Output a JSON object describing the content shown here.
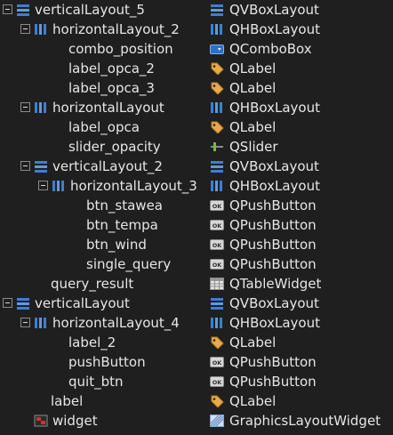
{
  "object_tree": {
    "rows": [
      {
        "object": "verticalLayout_5",
        "class": "QVBoxLayout",
        "depth": 0,
        "expanded": true,
        "object_icon": "vbox-layout-icon",
        "class_icon": "vbox-layout-icon"
      },
      {
        "object": "horizontalLayout_2",
        "class": "QHBoxLayout",
        "depth": 1,
        "expanded": true,
        "object_icon": "hbox-layout-icon",
        "class_icon": "hbox-layout-icon"
      },
      {
        "object": "combo_position",
        "class": "QComboBox",
        "depth": 2,
        "object_icon": "",
        "class_icon": "combobox-icon"
      },
      {
        "object": "label_opca_2",
        "class": "QLabel",
        "depth": 2,
        "object_icon": "",
        "class_icon": "label-icon"
      },
      {
        "object": "label_opca_3",
        "class": "QLabel",
        "depth": 2,
        "object_icon": "",
        "class_icon": "label-icon"
      },
      {
        "object": "horizontalLayout",
        "class": "QHBoxLayout",
        "depth": 1,
        "expanded": true,
        "object_icon": "hbox-layout-icon",
        "class_icon": "hbox-layout-icon"
      },
      {
        "object": "label_opca",
        "class": "QLabel",
        "depth": 2,
        "object_icon": "",
        "class_icon": "label-icon"
      },
      {
        "object": "slider_opacity",
        "class": "QSlider",
        "depth": 2,
        "object_icon": "",
        "class_icon": "slider-icon"
      },
      {
        "object": "verticalLayout_2",
        "class": "QVBoxLayout",
        "depth": 1,
        "expanded": true,
        "object_icon": "vbox-layout-icon",
        "class_icon": "vbox-layout-icon"
      },
      {
        "object": "horizontalLayout_3",
        "class": "QHBoxLayout",
        "depth": 2,
        "expanded": true,
        "object_icon": "hbox-layout-icon",
        "class_icon": "hbox-layout-icon"
      },
      {
        "object": "btn_stawea",
        "class": "QPushButton",
        "depth": 3,
        "object_icon": "",
        "class_icon": "push-button-icon"
      },
      {
        "object": "btn_tempa",
        "class": "QPushButton",
        "depth": 3,
        "object_icon": "",
        "class_icon": "push-button-icon"
      },
      {
        "object": "btn_wind",
        "class": "QPushButton",
        "depth": 3,
        "object_icon": "",
        "class_icon": "push-button-icon"
      },
      {
        "object": "single_query",
        "class": "QPushButton",
        "depth": 3,
        "object_icon": "",
        "class_icon": "push-button-icon"
      },
      {
        "object": "query_result",
        "class": "QTableWidget",
        "depth": 1,
        "object_icon": "",
        "class_icon": "table-widget-icon"
      },
      {
        "object": "verticalLayout",
        "class": "QVBoxLayout",
        "depth": 0,
        "expanded": true,
        "object_icon": "vbox-layout-icon",
        "class_icon": "vbox-layout-icon"
      },
      {
        "object": "horizontalLayout_4",
        "class": "QHBoxLayout",
        "depth": 1,
        "expanded": true,
        "object_icon": "hbox-layout-icon",
        "class_icon": "hbox-layout-icon"
      },
      {
        "object": "label_2",
        "class": "QLabel",
        "depth": 2,
        "object_icon": "",
        "class_icon": "label-icon"
      },
      {
        "object": "pushButton",
        "class": "QPushButton",
        "depth": 2,
        "object_icon": "",
        "class_icon": "push-button-icon"
      },
      {
        "object": "quit_btn",
        "class": "QPushButton",
        "depth": 2,
        "object_icon": "",
        "class_icon": "push-button-icon"
      },
      {
        "object": "label",
        "class": "QLabel",
        "depth": 1,
        "object_icon": "",
        "class_icon": "label-icon"
      },
      {
        "object": "widget",
        "class": "GraphicsLayoutWidget",
        "depth": 1,
        "object_icon": "graphics-widget-icon",
        "class_icon": "graphics-layout-widget-icon"
      }
    ]
  }
}
